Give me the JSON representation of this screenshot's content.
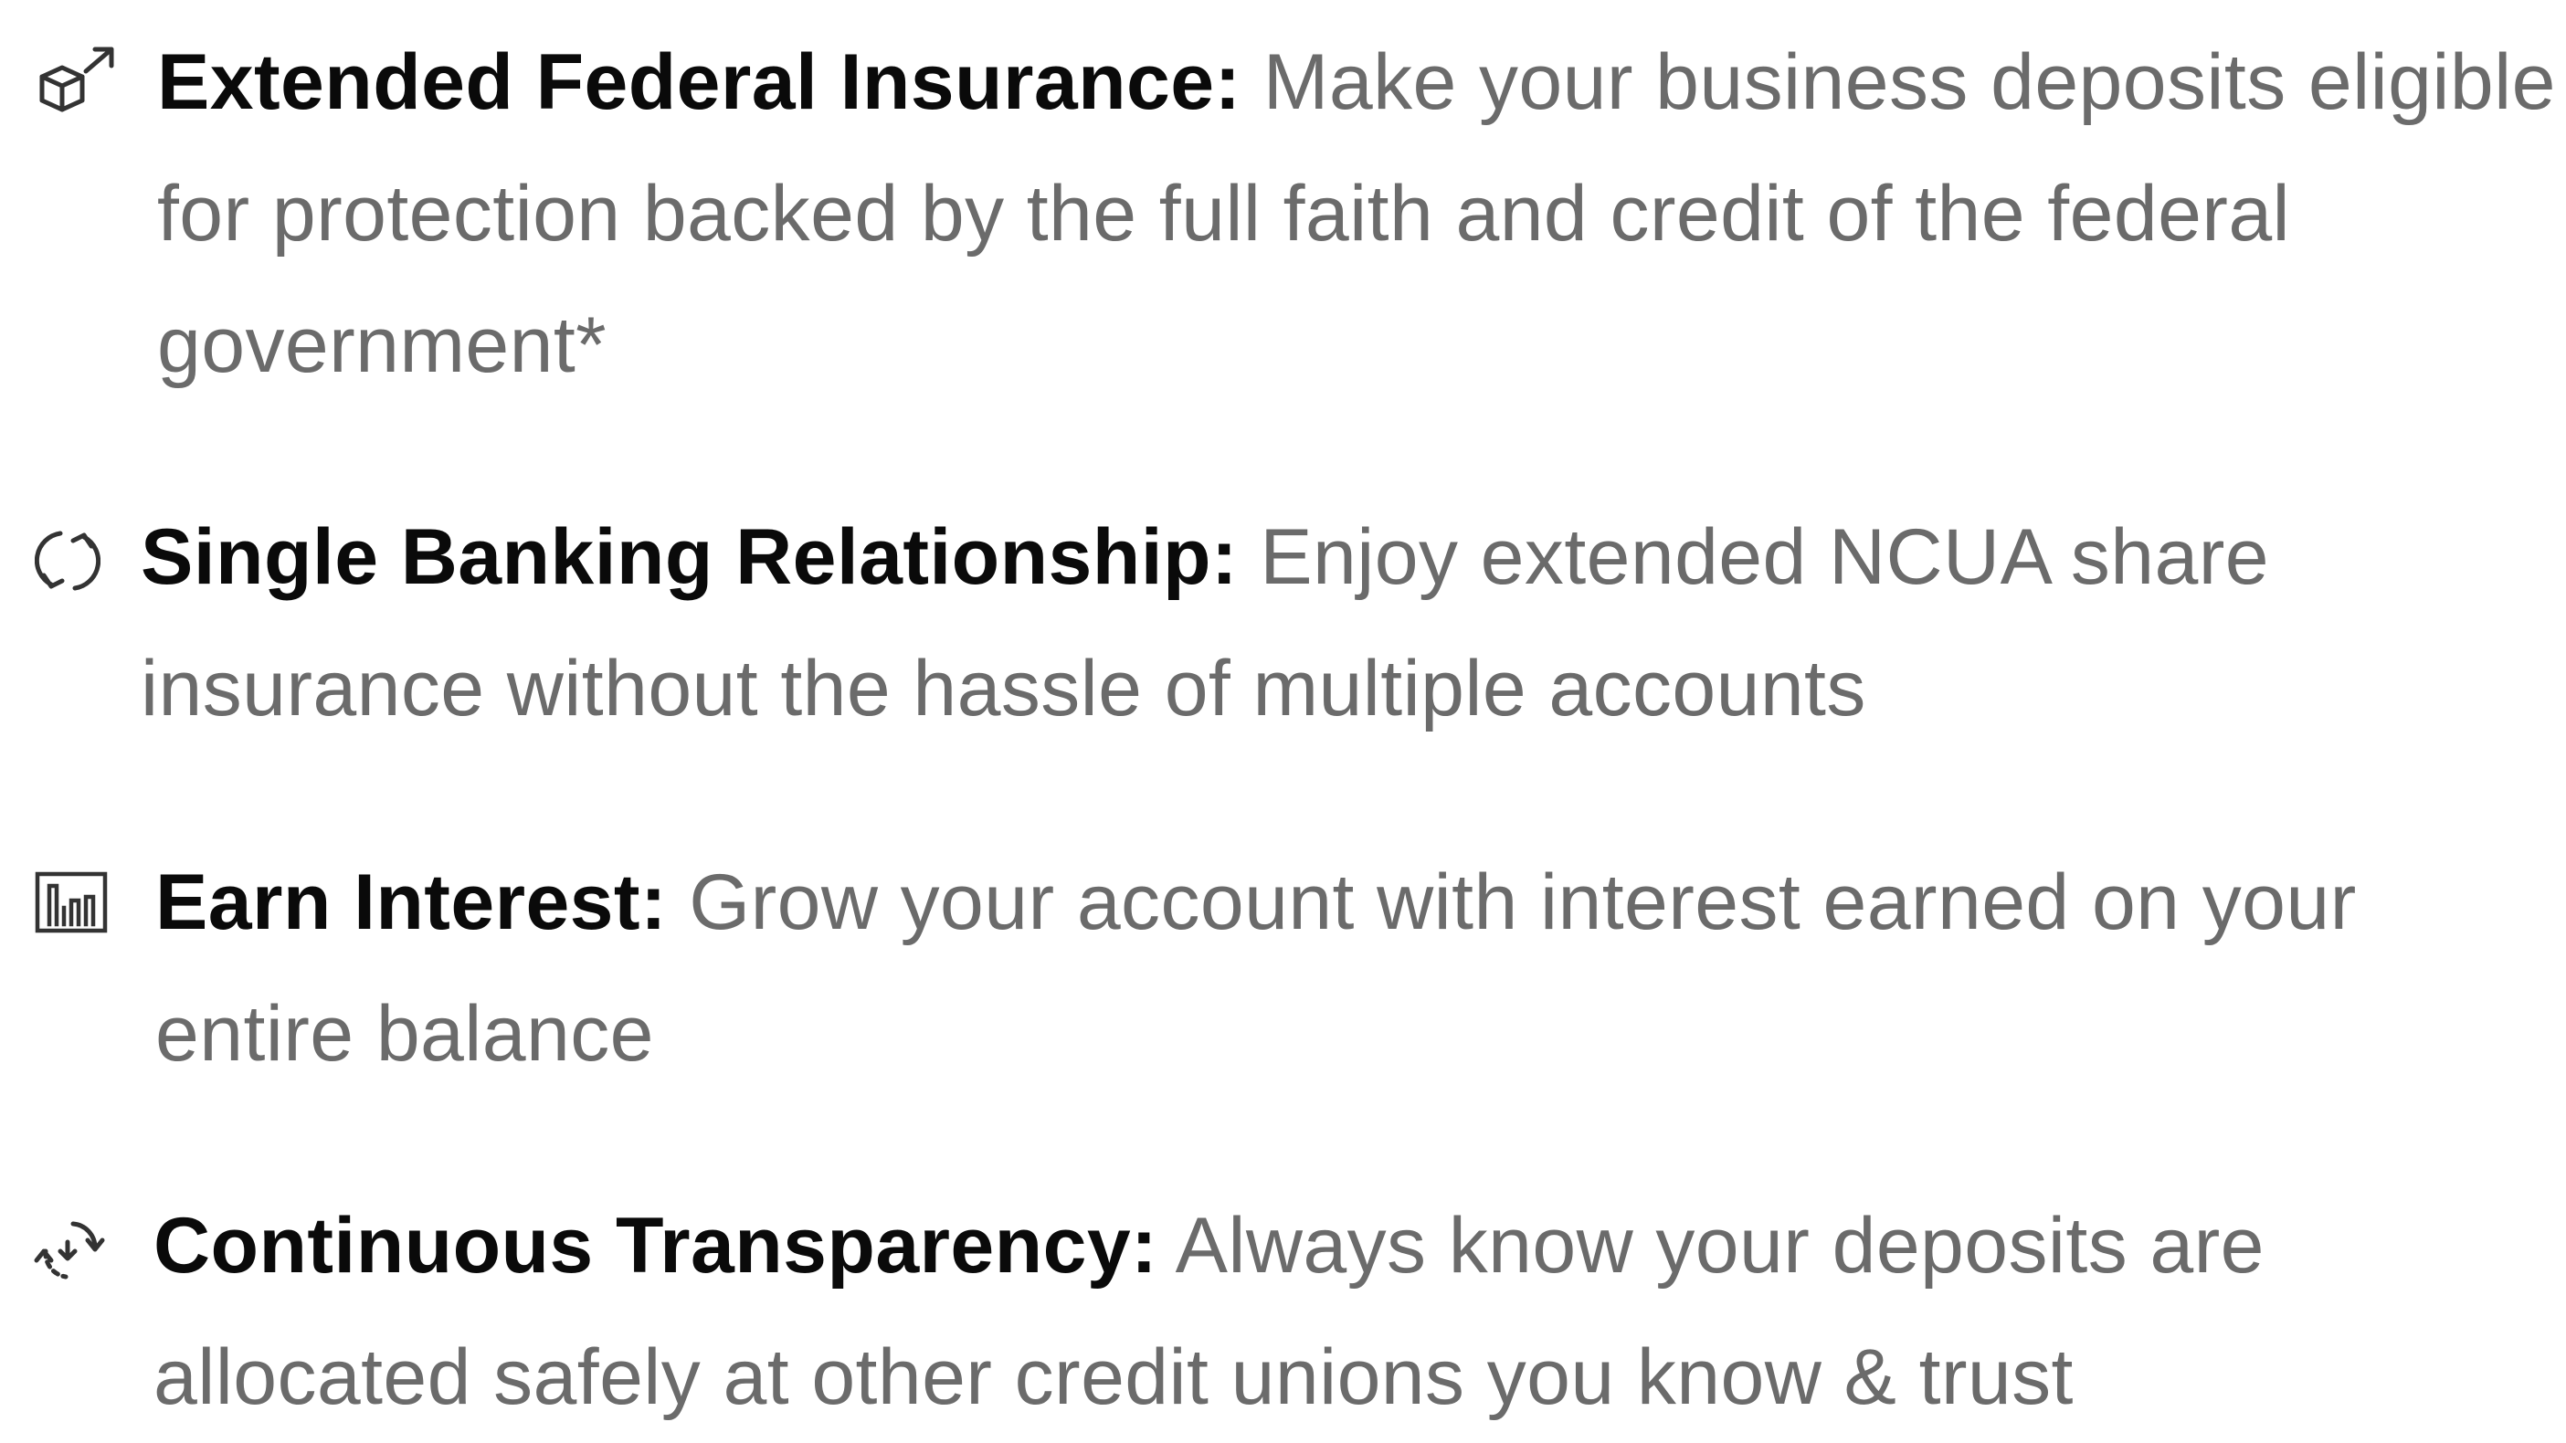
{
  "features": [
    {
      "icon": "box-arrow-icon",
      "title": "Extended Federal Insurance:",
      "description": "Make your business deposits eligible for protection backed by the full faith and credit of the federal government*"
    },
    {
      "icon": "refresh-cycle-icon",
      "title": "Single Banking Relationship:",
      "description": "Enjoy extended NCUA share insurance without the hassle of multiple accounts"
    },
    {
      "icon": "bar-chart-icon",
      "title": "Earn Interest:",
      "description": "Grow your account with interest earned on your entire balance"
    },
    {
      "icon": "sync-dashed-icon",
      "title": "Continuous Transparency:",
      "description": "Always know your deposits are allocated safely at other credit unions you know & trust"
    }
  ],
  "colors": {
    "title": "#0a0a0a",
    "description": "#6b6b6b",
    "icon_stroke": "#333333",
    "background": "#ffffff"
  }
}
